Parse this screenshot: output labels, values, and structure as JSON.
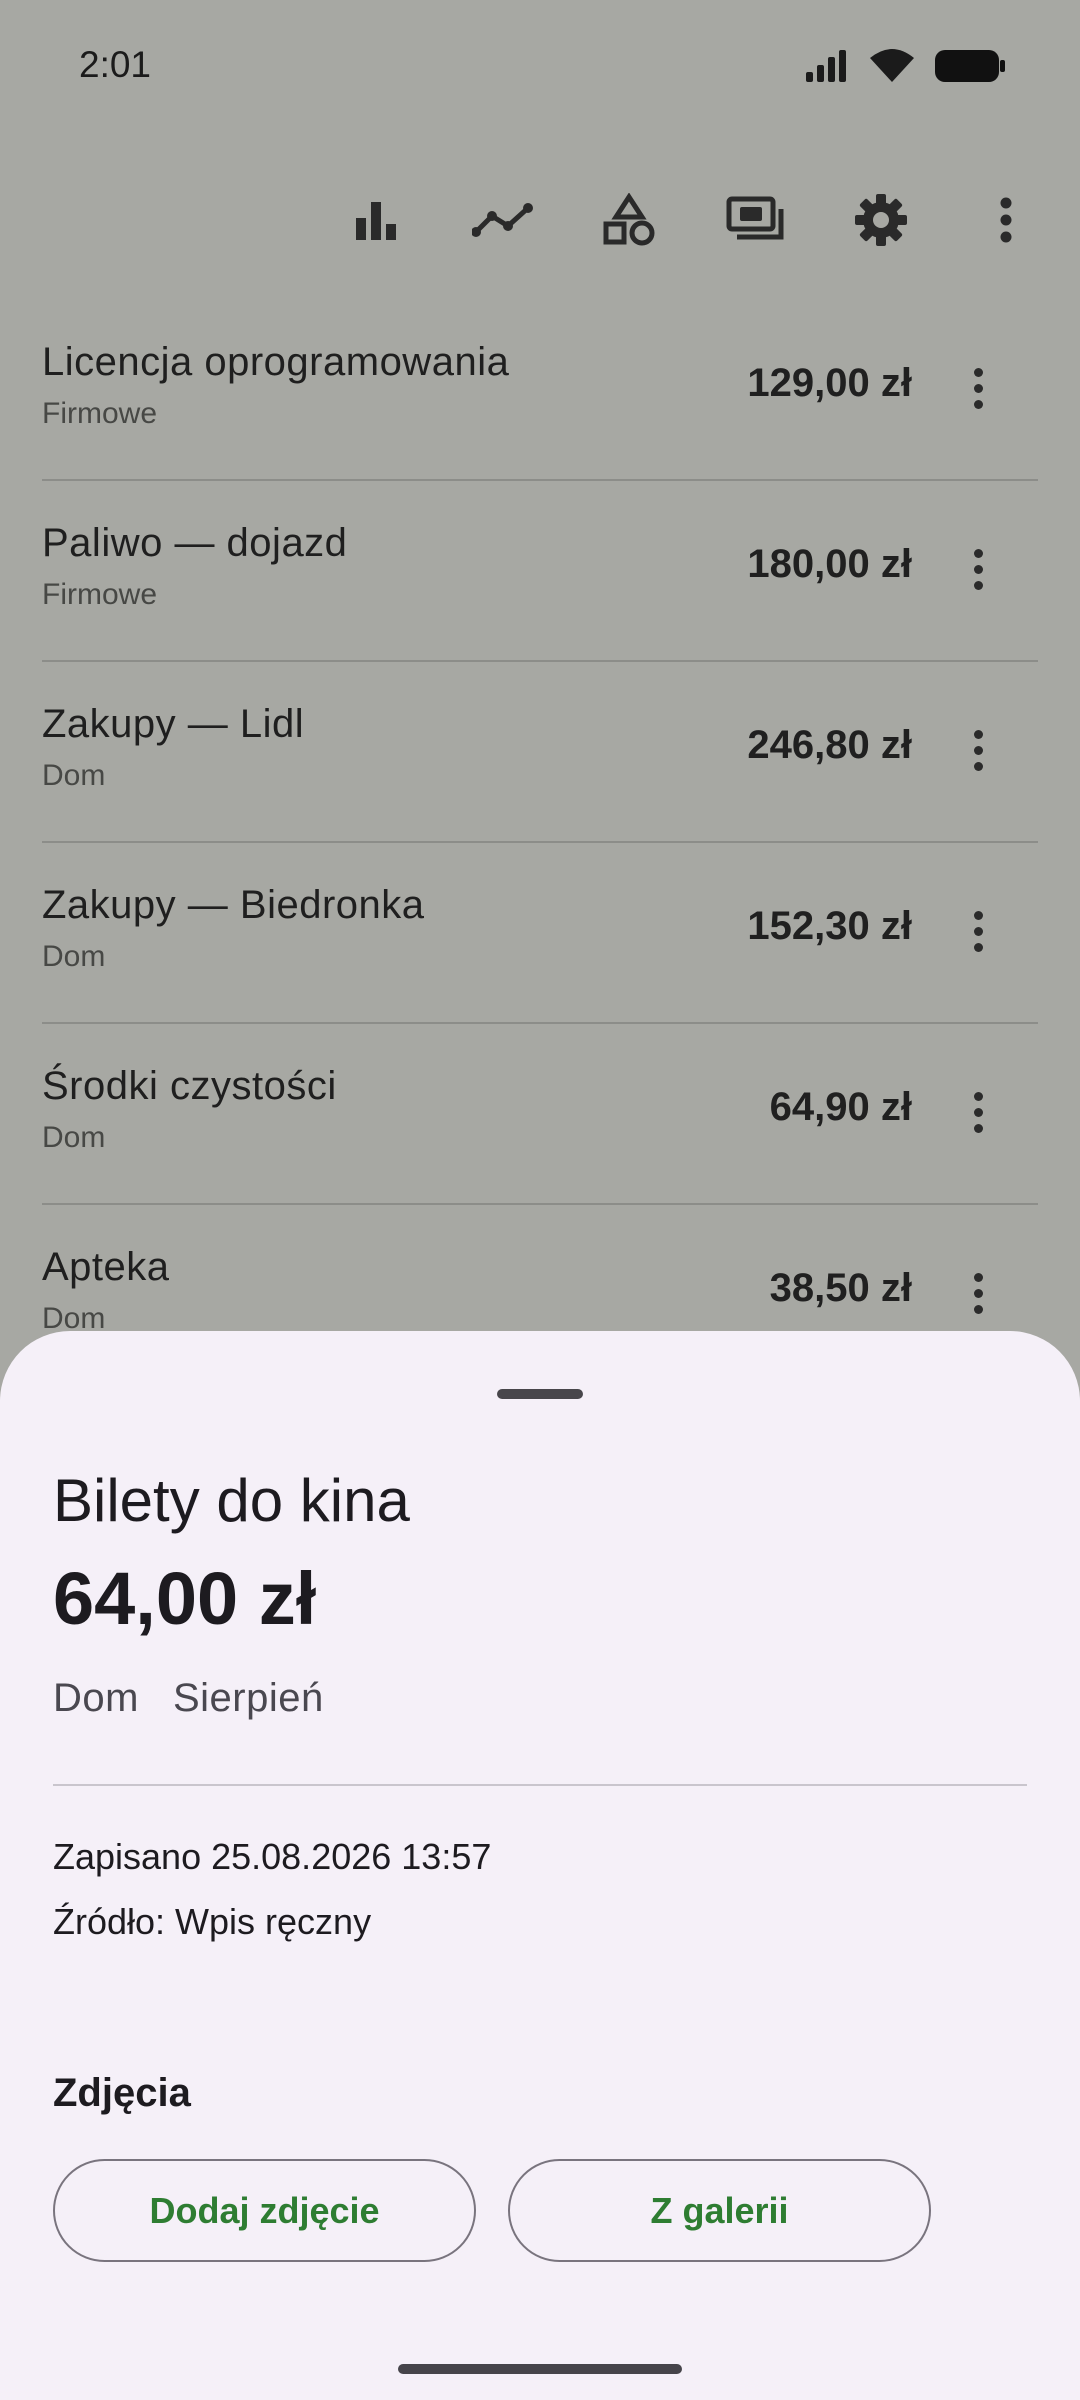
{
  "status_bar": {
    "time": "2:01",
    "icons": [
      "signal-icon",
      "wifi-icon",
      "battery-icon"
    ]
  },
  "toolbar": {
    "icons": [
      "bar-chart-icon",
      "line-chart-icon",
      "categories-icon",
      "money-icon",
      "gear-icon",
      "more-vert-icon"
    ]
  },
  "expenses": [
    {
      "title": "Licencja oprogramowania",
      "category": "Firmowe",
      "amount": "129,00 zł"
    },
    {
      "title": "Paliwo — dojazd",
      "category": "Firmowe",
      "amount": "180,00 zł"
    },
    {
      "title": "Zakupy — Lidl",
      "category": "Dom",
      "amount": "246,80 zł"
    },
    {
      "title": "Zakupy — Biedronka",
      "category": "Dom",
      "amount": "152,30 zł"
    },
    {
      "title": "Środki czystości",
      "category": "Dom",
      "amount": "64,90 zł"
    },
    {
      "title": "Apteka",
      "category": "Dom",
      "amount": "38,50 zł"
    }
  ],
  "sheet": {
    "title": "Bilety do kina",
    "amount": "64,00 zł",
    "category": "Dom",
    "month": "Sierpień",
    "saved": "Zapisano 25.08.2026 13:57",
    "source": "Źródło: Wpis ręczny",
    "photos_heading": "Zdjęcia",
    "add_photo_label": "Dodaj zdjęcie",
    "gallery_label": "Z galerii"
  },
  "colors": {
    "accent_green": "#2e7d32",
    "scrim": "#a7a8a3",
    "sheet_bg": "#f5f0f8"
  }
}
